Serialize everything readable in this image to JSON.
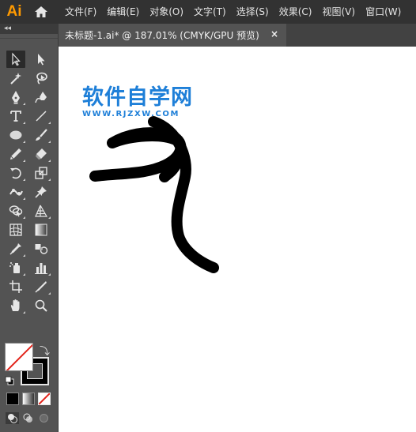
{
  "app": {
    "logo": "Ai"
  },
  "menu": [
    "文件(F)",
    "编辑(E)",
    "对象(O)",
    "文字(T)",
    "选择(S)",
    "效果(C)",
    "视图(V)",
    "窗口(W)"
  ],
  "tab": {
    "title": "未标题-1.ai* @ 187.01% (CMYK/GPU 预览)",
    "close": "×"
  },
  "toolbar": {
    "collapse": "◂◂"
  },
  "fill_stroke": {
    "swap": "⤵"
  },
  "canvas": {
    "watermark_title": "软件自学网",
    "watermark_url": "WWW.RJZXW.COM"
  },
  "colors": {
    "accent_logo": "#ff9a00",
    "watermark": "#1e7fd8",
    "stroke": "#000000",
    "ui_dark": "#323232",
    "ui_panel": "#535353"
  }
}
